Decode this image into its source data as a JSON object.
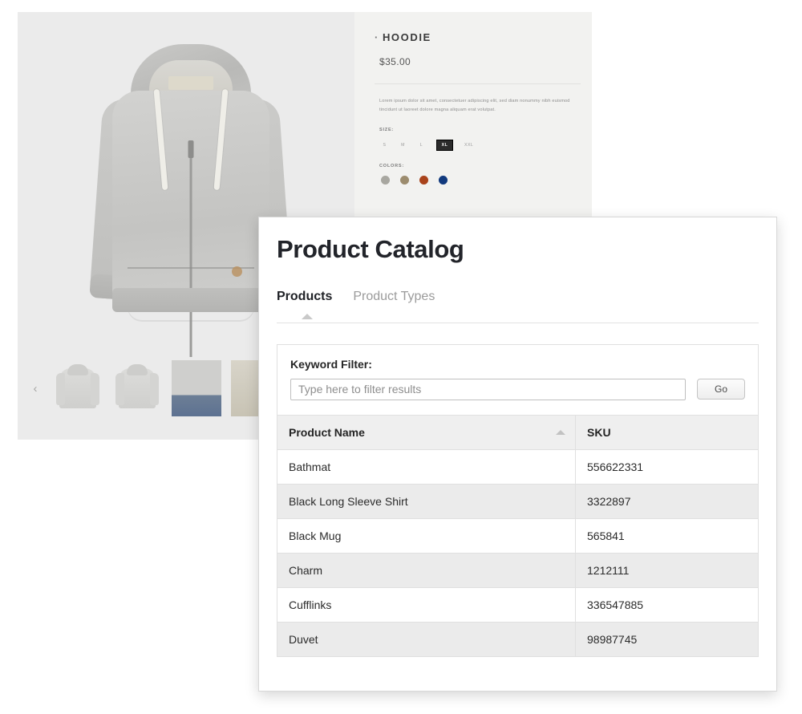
{
  "background_page": {
    "product_title": "HOODIE",
    "price": "$35.00",
    "description": "Lorem ipsum dolor sit amet, consectetuer adipiscing elit, sed diam nonummy nibh euismod tincidunt ut laoreet dolore magna aliquam erat volutpat.",
    "size_label": "SIZE:",
    "sizes": [
      "S",
      "M",
      "L",
      "XL",
      "XXL"
    ],
    "selected_size": "XL",
    "colors_label": "COLORS:",
    "colors": [
      "#a8a7a0",
      "#9c8c6e",
      "#a9431b",
      "#123a7e"
    ],
    "prev_arrow": "‹"
  },
  "dialog": {
    "title": "Product Catalog",
    "tabs": [
      {
        "label": "Products",
        "active": true
      },
      {
        "label": "Product Types",
        "active": false
      }
    ],
    "filter": {
      "label": "Keyword Filter:",
      "placeholder": "Type here to filter results",
      "value": "",
      "go_label": "Go"
    },
    "table": {
      "columns": [
        "Product Name",
        "SKU"
      ],
      "sorted_column": "Product Name",
      "sort_direction": "asc",
      "rows": [
        {
          "name": "Bathmat",
          "sku": "556622331"
        },
        {
          "name": "Black Long Sleeve Shirt",
          "sku": "3322897"
        },
        {
          "name": "Black Mug",
          "sku": "565841"
        },
        {
          "name": "Charm",
          "sku": "1212111"
        },
        {
          "name": "Cufflinks",
          "sku": "336547885"
        },
        {
          "name": "Duvet",
          "sku": "98987745"
        }
      ]
    }
  }
}
